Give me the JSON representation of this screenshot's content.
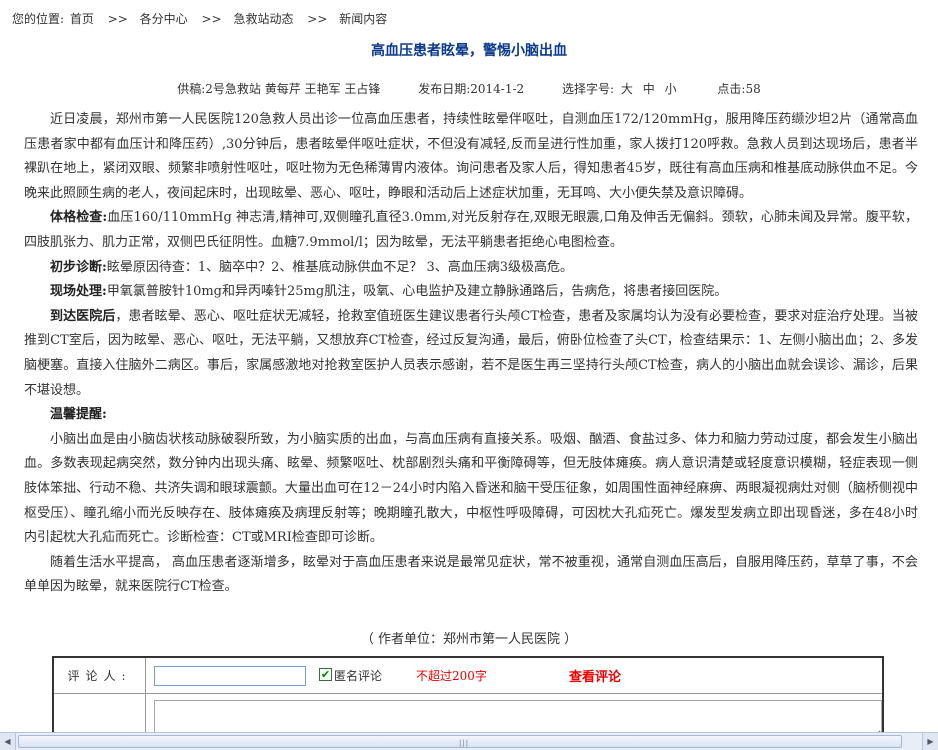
{
  "breadcrumb": {
    "prefix": "您的位置:",
    "items": [
      "首页",
      "各分中心",
      "急救站动态",
      "新闻内容"
    ],
    "separator": ">>"
  },
  "article": {
    "title": "高血压患者眩晕，警惕小脑出血",
    "meta": {
      "source": "供稿:2号急救站 黄每芹  王艳军 王占锋",
      "date": "发布日期:2014-1-2",
      "font_size_label": "选择字号:",
      "font_sizes": [
        "大",
        "中",
        "小"
      ],
      "clicks": "点击:58"
    },
    "paragraphs": [
      {
        "lead": "",
        "text": "近日凌晨，郑州市第一人民医院120急救人员出诊一位高血压患者，持续性眩晕伴呕吐，自测血压172/120mmHg，服用降压药缬沙坦2片（通常高血压患者家中都有血压计和降压药）,30分钟后，患者眩晕伴呕吐症状，不但没有减轻,反而呈进行性加重，家人拨打120呼救。急救人员到达现场后，患者半裸趴在地上，紧闭双眼、频繁非喷射性呕吐，呕吐物为无色稀薄胃内液体。询问患者及家人后，得知患者45岁，既往有高血压病和椎基底动脉供血不足。今晚来此照顾生病的老人，夜间起床时，出现眩晕、恶心、呕吐，睁眼和活动后上述症状加重，无耳鸣、大小便失禁及意识障碍。"
      },
      {
        "lead": "体格检查:",
        "text": "血压160/110mmHg 神志清,精神可,双侧瞳孔直径3.0mm,对光反射存在,双眼无眼震,口角及伸舌无偏斜。颈软，心肺未闻及异常。腹平软，四肢肌张力、肌力正常，双侧巴氏征阴性。血糖7.9mmol/l；因为眩晕，无法平躺患者拒绝心电图检查。"
      },
      {
        "lead": "初步诊断:",
        "text": "眩晕原因待查：1、脑卒中？2、椎基底动脉供血不足？ 3、高血压病3级极高危。"
      },
      {
        "lead": "现场处理:",
        "text": "甲氧氯普胺针10mg和异丙嗪针25mg肌注，吸氧、心电监护及建立静脉通路后，告病危，将患者接回医院。"
      },
      {
        "lead": "到达医院后",
        "text": "，患者眩晕、恶心、呕吐症状无减轻，抢救室值班医生建议患者行头颅CT检查，患者及家属均认为没有必要检查，要求对症治疗处理。当被推到CT室后，因为眩晕、恶心、呕吐，无法平躺，又想放弃CT检查，经过反复沟通，最后，俯卧位检查了头CT，检查结果示：1、左侧小脑出血；2、多发脑梗塞。直接入住脑外二病区。事后，家属感激地对抢救室医护人员表示感谢，若不是医生再三坚持行头颅CT检查，病人的小脑出血就会误诊、漏诊，后果不堪设想。"
      },
      {
        "lead": "温馨提醒:",
        "text": ""
      },
      {
        "lead": "",
        "text": "小脑出血是由小脑齿状核动脉破裂所致，为小脑实质的出血，与高血压病有直接关系。吸烟、酗酒、食盐过多、体力和脑力劳动过度，都会发生小脑出血。多数表现起病突然，数分钟内出现头痛、眩晕、频繁呕吐、枕部剧烈头痛和平衡障碍等，但无肢体瘫痪。病人意识清楚或轻度意识模糊，轻症表现一侧肢体笨拙、行动不稳、共济失调和眼球震颤。大量出血可在12－24小时内陷入昏迷和脑干受压征象，如周围性面神经麻痹、两眼凝视病灶对侧（脑桥侧视中枢受压）、瞳孔缩小而光反映存在、肢体瘫痪及病理反射等；晚期瞳孔散大，中枢性呼吸障碍，可因枕大孔疝死亡。爆发型发病立即出现昏迷，多在48小时内引起枕大孔疝而死亡。诊断检查：CT或MRI检查即可诊断。"
      },
      {
        "lead": "",
        "text": "随着生活水平提高， 高血压患者逐渐增多，眩晕对于高血压患者来说是最常见症状，常不被重视，通常自测血压高后，自服用降压药，草草了事，不会单单因为眩晕，就来医院行CT检查。"
      }
    ],
    "author": "（ 作者单位：郑州市第一人民医院  ）"
  },
  "comment": {
    "label": "评论人:",
    "name_value": "",
    "anonymous_label": "匿名评论",
    "anonymous_checked": "✔",
    "limit": "不超过200字",
    "view_link": "查看评论",
    "body_value": ""
  },
  "scrollbar": {
    "left_arrow": "◀",
    "right_arrow": "▶",
    "grip": "|||"
  }
}
